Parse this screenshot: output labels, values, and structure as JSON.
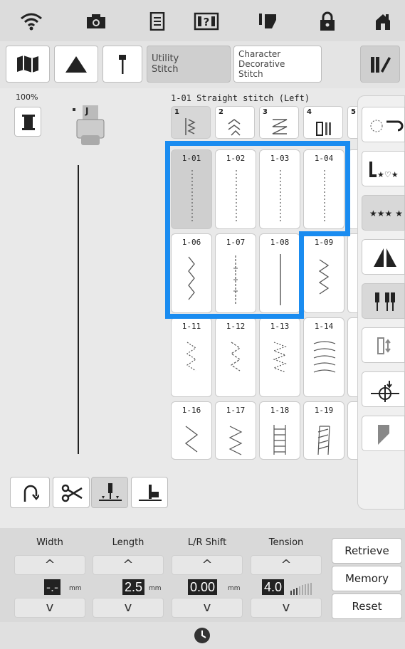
{
  "toolbar": {
    "utility_label": "Utility\nStitch",
    "character_label": "Character\nDecorative\nStitch"
  },
  "zoom": "100%",
  "presser_foot": "J",
  "stitch_title": "1-01 Straight stitch (Left)",
  "category_tabs": [
    "1",
    "2",
    "3",
    "4",
    "5"
  ],
  "stitches_row1": [
    "1-01",
    "1-02",
    "1-03",
    "1-04"
  ],
  "stitches_row2": [
    "1-06",
    "1-07",
    "1-08",
    "1-09"
  ],
  "stitches_row3": [
    "1-11",
    "1-12",
    "1-13",
    "1-14"
  ],
  "stitches_row4": [
    "1-16",
    "1-17",
    "1-18",
    "1-19"
  ],
  "controls": {
    "width": {
      "label": "Width",
      "value": "-.-",
      "unit": "mm"
    },
    "length": {
      "label": "Length",
      "value": "2.5",
      "unit": "mm"
    },
    "lr_shift": {
      "label": "L/R Shift",
      "value": "0.00",
      "unit": "mm"
    },
    "tension": {
      "label": "Tension",
      "value": "4.0"
    }
  },
  "buttons": {
    "retrieve": "Retrieve",
    "memory": "Memory",
    "reset": "Reset"
  },
  "colors": {
    "highlight": "#1a8cf0"
  }
}
